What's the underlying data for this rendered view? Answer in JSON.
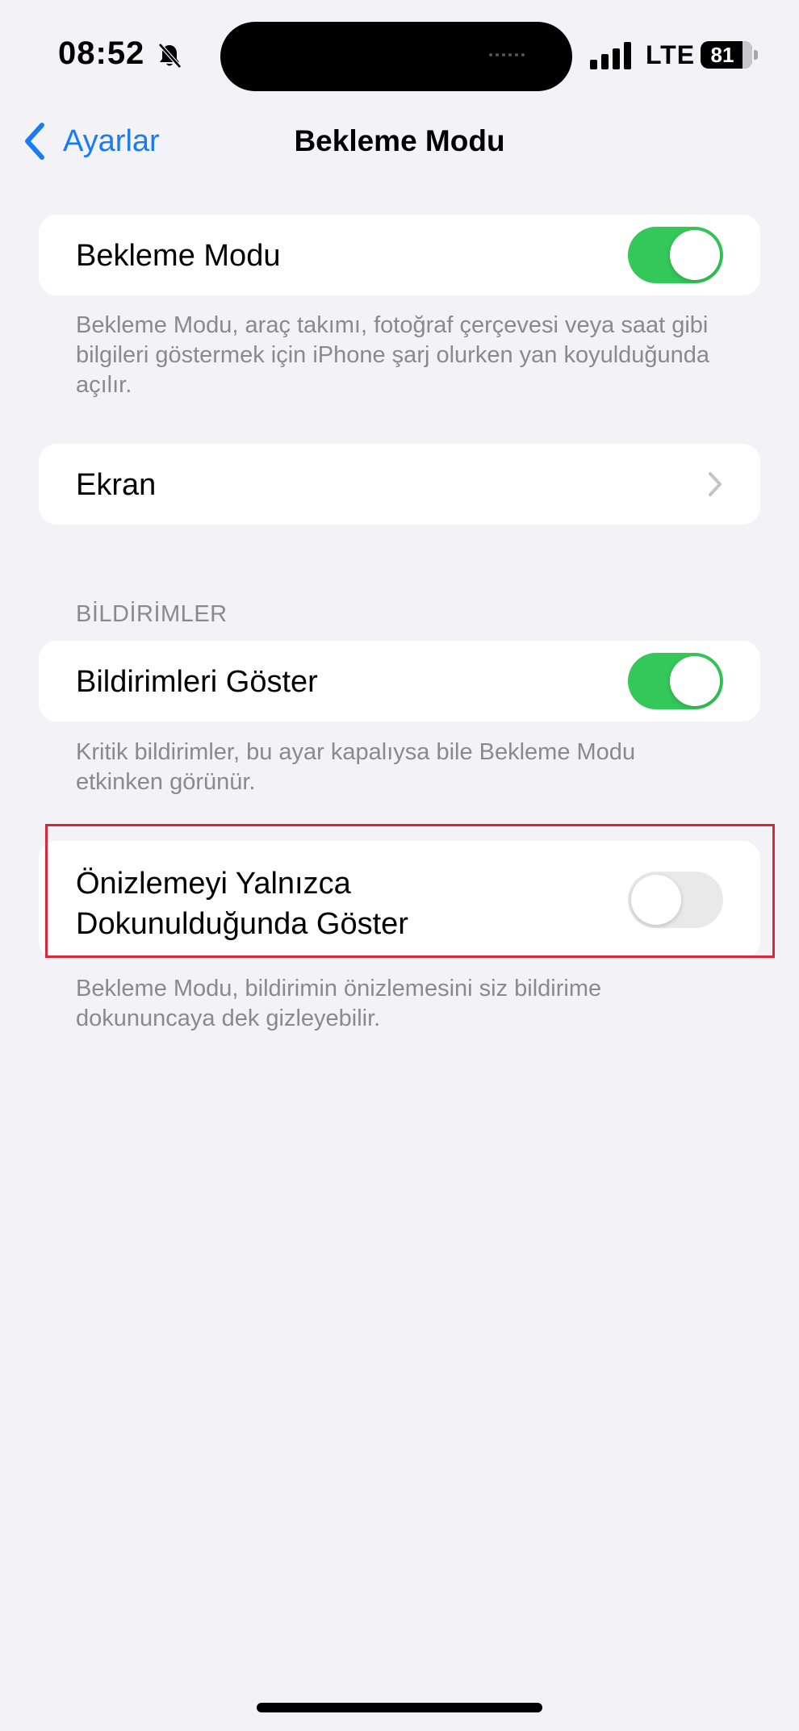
{
  "status_bar": {
    "time": "08:52",
    "network": "LTE",
    "battery": "81",
    "icons": [
      "bell-slash-icon",
      "signal-icon",
      "battery-icon"
    ]
  },
  "nav": {
    "back_label": "Ayarlar",
    "title": "Bekleme Modu",
    "back_icon": "chevron-left-icon"
  },
  "standby": {
    "label": "Bekleme Modu",
    "toggle_on": true,
    "footer": "Bekleme Modu, araç takımı, fotoğraf çerçevesi veya saat gibi bilgileri göstermek için iPhone şarj olurken yan koyulduğunda açılır."
  },
  "display": {
    "label": "Ekran",
    "icon": "chevron-right-icon"
  },
  "notifications": {
    "header": "BİLDİRİMLER",
    "show_label": "Bildirimleri Göster",
    "show_toggle_on": true,
    "show_footer": "Kritik bildirimler, bu ayar kapalıysa bile Bekleme Modu etkinken görünür.",
    "preview_label_line1": "Önizlemeyi Yalnızca",
    "preview_label_line2": "Dokunulduğunda Göster",
    "preview_toggle_on": false,
    "preview_footer": "Bekleme Modu, bildirimin önizlemesini siz bildirime dokununcaya dek gizleyebilir."
  },
  "colors": {
    "accent": "#1a7cf2",
    "toggle_on": "#34c759",
    "toggle_off": "#e9e9ea",
    "background": "#f2f2f7",
    "highlight": "#d6293b"
  }
}
